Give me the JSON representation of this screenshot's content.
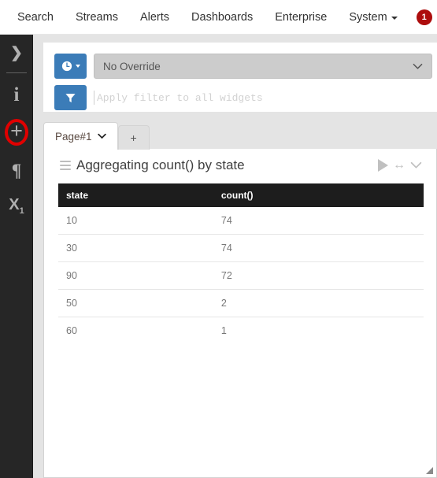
{
  "navbar": {
    "items": [
      {
        "label": "Search"
      },
      {
        "label": "Streams"
      },
      {
        "label": "Alerts"
      },
      {
        "label": "Dashboards"
      },
      {
        "label": "Enterprise"
      },
      {
        "label": "System"
      }
    ],
    "system_has_caret": true,
    "badge": {
      "count": "1",
      "color": "#ad0d0d"
    }
  },
  "sidebar": {
    "items": [
      {
        "name": "expand",
        "glyph": "❯"
      },
      {
        "name": "info",
        "glyph": "i"
      },
      {
        "name": "add",
        "glyph": "+",
        "highlighted": true,
        "highlight_color": "#e00000"
      },
      {
        "name": "paragraph",
        "glyph": "¶"
      },
      {
        "name": "subscript",
        "glyph": "X",
        "sub": "1"
      }
    ]
  },
  "controls": {
    "timerange": {
      "icon": "clock-icon",
      "label": "",
      "color": "#3b7cb8"
    },
    "override_select": {
      "value": "No Override",
      "options": [
        "No Override"
      ]
    },
    "filter": {
      "icon": "funnel-icon",
      "placeholder": "Apply filter to all widgets",
      "value": ""
    }
  },
  "tabs": {
    "items": [
      {
        "label": "Page#1",
        "active": true,
        "has_chevron": true
      },
      {
        "label": "+",
        "active": false,
        "has_chevron": false
      }
    ]
  },
  "widget": {
    "title": "Aggregating count() by state",
    "actions": [
      {
        "name": "play",
        "glyph": "▶"
      },
      {
        "name": "resize-horizontal",
        "glyph": "↔"
      },
      {
        "name": "collapse",
        "glyph": "⌄"
      }
    ]
  },
  "chart_data": {
    "type": "table",
    "title": "Aggregating count() by state",
    "columns": [
      "state",
      "count()"
    ],
    "rows": [
      [
        "10",
        "74"
      ],
      [
        "30",
        "74"
      ],
      [
        "90",
        "72"
      ],
      [
        "50",
        "2"
      ],
      [
        "60",
        "1"
      ]
    ],
    "categories": [
      "10",
      "30",
      "90",
      "50",
      "60"
    ],
    "values": [
      74,
      74,
      72,
      2,
      1
    ],
    "xlabel": "state",
    "ylabel": "count()"
  }
}
